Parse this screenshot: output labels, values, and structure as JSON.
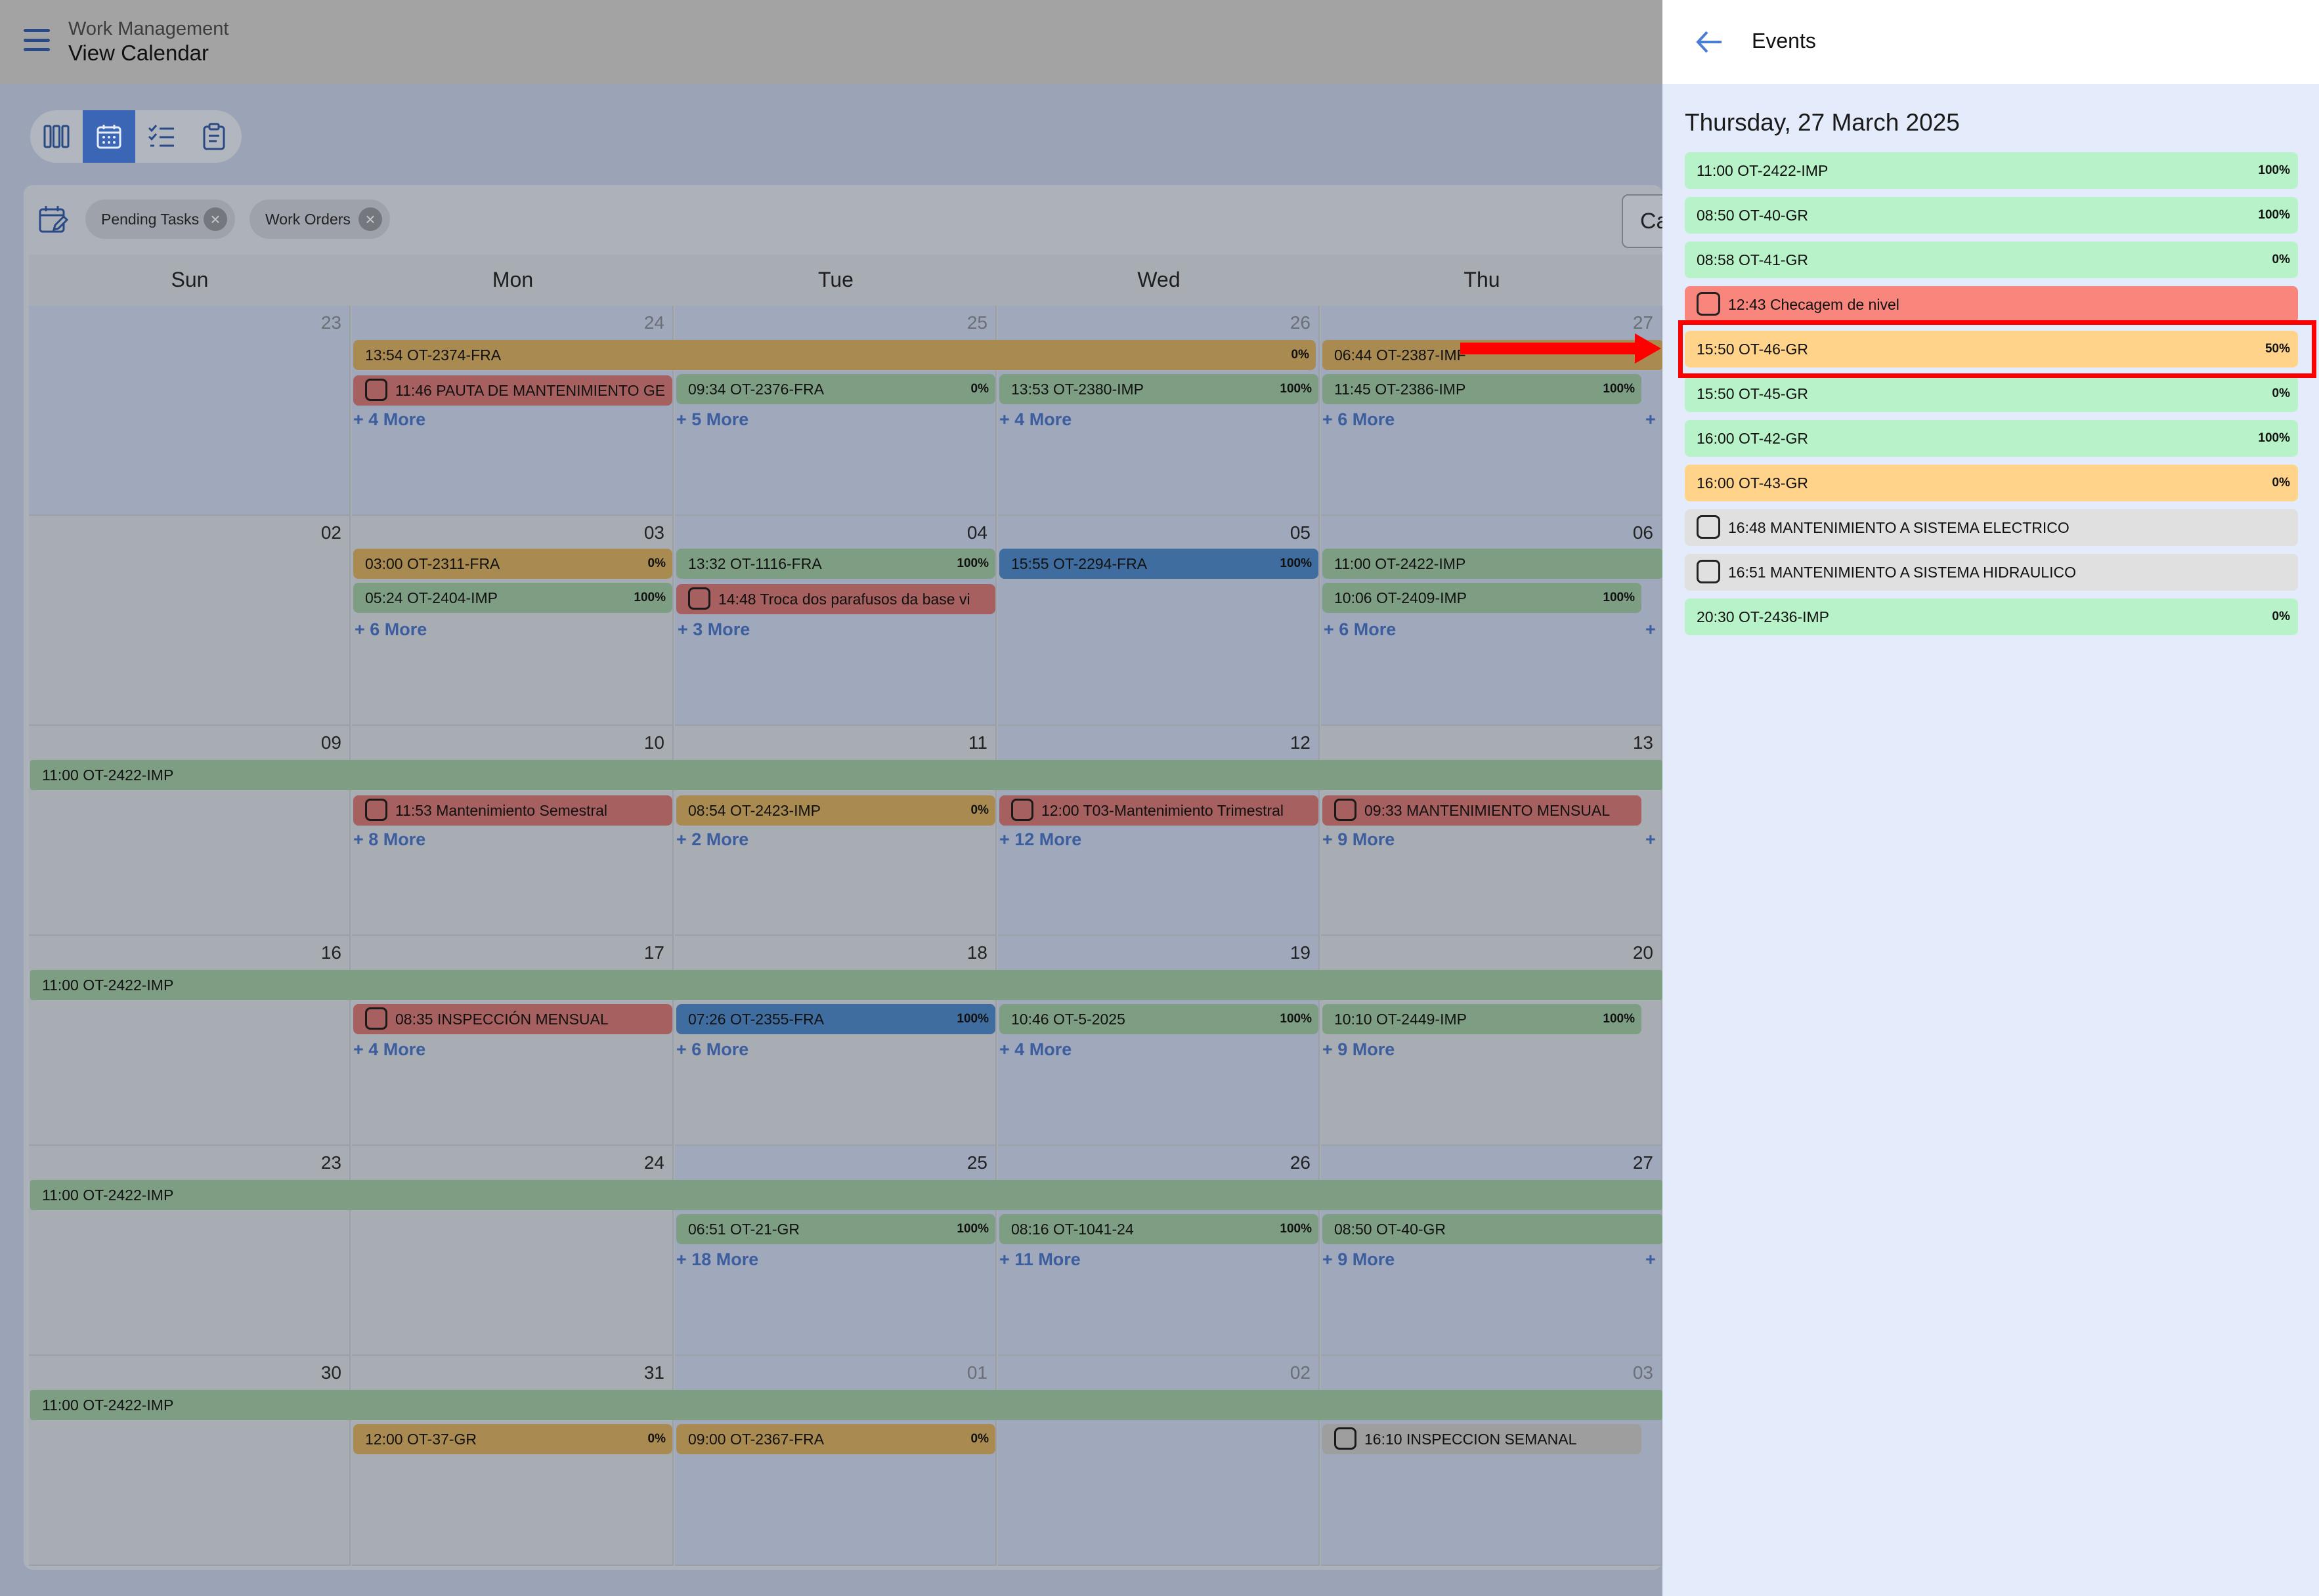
{
  "header": {
    "subtitle": "Work Management",
    "title": "View Calendar"
  },
  "view_toggle": [
    "columns-icon",
    "calendar-icon",
    "checklist-icon",
    "clipboard-icon"
  ],
  "filters": {
    "chips": [
      "Pending Tasks",
      "Work Orders"
    ],
    "calendar_toggle_label": "Ca"
  },
  "weekdays": [
    "Sun",
    "Mon",
    "Tue",
    "Wed",
    "Thu"
  ],
  "weeks": [
    {
      "days": [
        "23",
        "24",
        "25",
        "26",
        "27"
      ],
      "span": {
        "label": "13:54 OT-2374-FRA",
        "pct": "0%"
      },
      "events": [
        {
          "text": "11:46 PAUTA DE MANTENIMIENTO GE",
          "pct": "",
          "check": true
        },
        {
          "text": "09:34 OT-2376-FRA",
          "pct": "0%"
        },
        {
          "text": "13:53 OT-2380-IMP",
          "pct": "100%"
        },
        {
          "text": "11:45 OT-2386-IMP",
          "pct": "100%"
        }
      ],
      "thu_top": {
        "text": "06:44 OT-2387-IMF",
        "pct": ""
      },
      "more": [
        "+ 4 More",
        "+ 5 More",
        "+ 4 More",
        "+ 6 More",
        "+"
      ]
    },
    {
      "days": [
        "02",
        "03",
        "04",
        "05",
        "06"
      ],
      "events": [
        {
          "text": "03:00 OT-2311-FRA",
          "pct": "0%"
        },
        {
          "text": "13:32 OT-1116-FRA",
          "pct": "100%"
        },
        {
          "text": "15:55 OT-2294-FRA",
          "pct": "100%"
        },
        {
          "text": "11:00 OT-2422-IMP",
          "pct": ""
        },
        {
          "text": "05:24 OT-2404-IMP",
          "pct": "100%"
        },
        {
          "text": "14:48 Troca dos parafusos da base vi",
          "pct": "",
          "check": true
        },
        {
          "text": "10:06 OT-2409-IMP",
          "pct": "100%"
        }
      ],
      "more": [
        "+ 6 More",
        "+ 3 More",
        "+ 6 More",
        "+"
      ]
    },
    {
      "days": [
        "09",
        "10",
        "11",
        "12",
        "13"
      ],
      "span": {
        "label": "11:00 OT-2422-IMP"
      },
      "events": [
        {
          "text": "11:53 Mantenimiento Semestral",
          "check": true
        },
        {
          "text": "08:54 OT-2423-IMP",
          "pct": "0%"
        },
        {
          "text": "12:00 T03-Mantenimiento Trimestral",
          "check": true
        },
        {
          "text": "09:33 MANTENIMIENTO MENSUAL",
          "check": true
        }
      ],
      "more": [
        "+ 8 More",
        "+ 2 More",
        "+ 12 More",
        "+ 9 More",
        "+"
      ]
    },
    {
      "days": [
        "16",
        "17",
        "18",
        "19",
        "20"
      ],
      "span": {
        "label": "11:00 OT-2422-IMP"
      },
      "events": [
        {
          "text": "08:35 INSPECCIÓN MENSUAL",
          "check": true
        },
        {
          "text": "07:26 OT-2355-FRA",
          "pct": "100%"
        },
        {
          "text": "10:46 OT-5-2025",
          "pct": "100%"
        },
        {
          "text": "10:10 OT-2449-IMP",
          "pct": "100%"
        }
      ],
      "more": [
        "+ 4 More",
        "+ 6 More",
        "+ 4 More",
        "+ 9 More"
      ]
    },
    {
      "days": [
        "23",
        "24",
        "25",
        "26",
        "27"
      ],
      "span": {
        "label": "11:00 OT-2422-IMP"
      },
      "events": [
        {
          "text": "06:51 OT-21-GR",
          "pct": "100%"
        },
        {
          "text": "08:16 OT-1041-24",
          "pct": "100%"
        },
        {
          "text": "08:50 OT-40-GR",
          "pct": ""
        }
      ],
      "more": [
        "+ 18 More",
        "+ 11 More",
        "+ 9 More",
        "+"
      ]
    },
    {
      "days": [
        "30",
        "31",
        "01",
        "02",
        "03"
      ],
      "span": {
        "label": "11:00 OT-2422-IMP"
      },
      "events": [
        {
          "text": "12:00 OT-37-GR",
          "pct": "0%"
        },
        {
          "text": "09:00 OT-2367-FRA",
          "pct": "0%"
        },
        {
          "text": "16:10 INSPECCION SEMANAL",
          "check": true
        }
      ]
    }
  ],
  "panel": {
    "title": "Events",
    "date": "Thursday, 27 March 2025",
    "events": [
      {
        "text": "11:00 OT-2422-IMP",
        "pct": "100%",
        "color": "#b8f2c8"
      },
      {
        "text": "08:50 OT-40-GR",
        "pct": "100%",
        "color": "#b8f2c8"
      },
      {
        "text": "08:58 OT-41-GR",
        "pct": "0%",
        "color": "#b8f2c8"
      },
      {
        "text": "12:43 Checagem de nivel",
        "pct": "",
        "check": true,
        "color": "#f9867d"
      },
      {
        "text": "15:50 OT-46-GR",
        "pct": "50%",
        "color": "#ffd48a",
        "highlighted": true
      },
      {
        "text": "15:50 OT-45-GR",
        "pct": "0%",
        "color": "#b8f2c8"
      },
      {
        "text": "16:00 OT-42-GR",
        "pct": "100%",
        "color": "#b8f2c8"
      },
      {
        "text": "16:00 OT-43-GR",
        "pct": "0%",
        "color": "#ffd48a"
      },
      {
        "text": "16:48 MANTENIMIENTO A SISTEMA ELECTRICO",
        "pct": "",
        "check": true,
        "color": "#e0e0e0"
      },
      {
        "text": "16:51 MANTENIMIENTO A SISTEMA HIDRAULICO",
        "pct": "",
        "check": true,
        "color": "#e0e0e0"
      },
      {
        "text": "20:30 OT-2436-IMP",
        "pct": "0%",
        "color": "#b8f2c8"
      }
    ]
  }
}
